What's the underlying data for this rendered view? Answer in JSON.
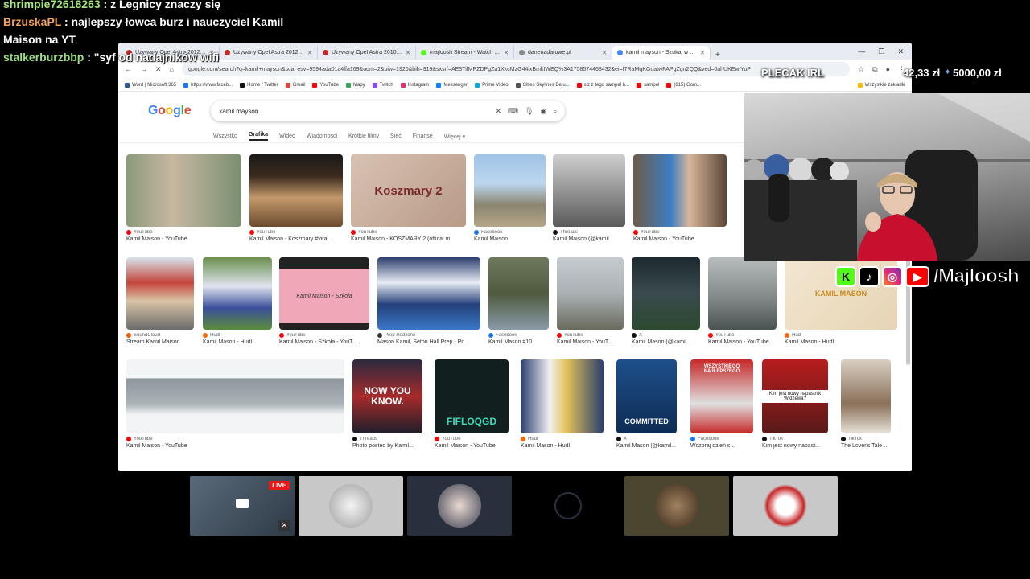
{
  "chat": [
    {
      "user": "shrimpie72618263",
      "user_color": "#a5e67a",
      "message": " : z Legnicy znaczy się"
    },
    {
      "user": "BrzuskaPL",
      "user_color": "#f2a25a",
      "message": " : najlepszy łowca burz i nauczyciel Kamil Maison na YT"
    },
    {
      "user": "stalkerburzbbp",
      "user_color": "#9be07d",
      "message": " : \"syf od nadajników wifi"
    }
  ],
  "browser": {
    "tabs": [
      {
        "title": "Używany Opel Astra 2012 - 1",
        "color": "#c62828"
      },
      {
        "title": "Używany Opel Astra 2012 - 1",
        "color": "#c62828"
      },
      {
        "title": "Używany Opel Astra 2010 - 1",
        "color": "#c62828"
      },
      {
        "title": "majloosh Stream - Watch Live",
        "color": "#53fc18"
      },
      {
        "title": "danenadarowe.pl",
        "color": "#888888"
      },
      {
        "title": "kamil mayson - Szukaj w Goog",
        "color": "#4285f4",
        "active": true
      }
    ],
    "new_tab": "+",
    "url": "google.com/search?q=kamil+mayson&sca_esv=9594ada01a4ffa169&udm=2&biw=1920&bih=919&sxsrf=AE3TifMPZDPgZa1XkcMzG44lxBmkIWEQ%3A1758574463432&ei=f7RaMqKGuatwPAPgZgn2QQ&ved=0ahUKEwiYuP",
    "bookmarks": [
      {
        "label": "Word | Microsoft 365",
        "color": "#2b579a"
      },
      {
        "label": "https://www.faceb...",
        "color": "#1877f2"
      },
      {
        "label": "Home / Twitter",
        "color": "#111111"
      },
      {
        "label": "Gmail",
        "color": "#ea4335"
      },
      {
        "label": "YouTube",
        "color": "#ff0000"
      },
      {
        "label": "Mapy",
        "color": "#34a853"
      },
      {
        "label": "Twitch",
        "color": "#9146ff"
      },
      {
        "label": "Instagram",
        "color": "#e1306c"
      },
      {
        "label": "Messenger",
        "color": "#0084ff"
      },
      {
        "label": "Prime Video",
        "color": "#00a8e1"
      },
      {
        "label": "Cities Skylines Delu...",
        "color": "#555555"
      },
      {
        "label": "siz z tego sampel b...",
        "color": "#ff0000"
      },
      {
        "label": "sampel",
        "color": "#ff0000"
      },
      {
        "label": "(815) Gom...",
        "color": "#ff0000"
      }
    ],
    "bookmarks_folder": "Wszystkie zakładki"
  },
  "google": {
    "logo": "Google",
    "query": "kamil mayson",
    "tabs": [
      "Wszystko",
      "Grafika",
      "Wideo",
      "Wiadomości",
      "Krótkie filmy",
      "Sieć",
      "Finanse",
      "Więcej"
    ],
    "active_tab": "Grafika",
    "results_row1": [
      {
        "source": "YouTube",
        "title": "Kamil Maison - YouTube",
        "src_color": "#ff0000"
      },
      {
        "source": "YouTube",
        "title": "Kamil Maison - Koszmary #viral...",
        "src_color": "#ff0000"
      },
      {
        "source": "YouTube",
        "title": "Kamil Maison - KOSZMARY 2 (offical m",
        "src_color": "#ff0000",
        "overlay": "Koszmary 2"
      },
      {
        "source": "Facebook",
        "title": "Kamil Maison",
        "src_color": "#1877f2"
      },
      {
        "source": "Threads",
        "title": "Kamil Maison (@kamil",
        "src_color": "#111111"
      },
      {
        "source": "YouTube",
        "title": "Kamil Maison - YouTube",
        "src_color": "#ff0000"
      }
    ],
    "results_row2": [
      {
        "source": "SoundCloud",
        "title": "Stream Kamil Maison",
        "src_color": "#ff5500"
      },
      {
        "source": "Hudl",
        "title": "Kamil Mason - Hudl",
        "src_color": "#ff6600"
      },
      {
        "source": "YouTube",
        "title": "Kamil Maison - Szkoła - YouT...",
        "src_color": "#ff0000",
        "overlay": "Kamil Maison - Szkoła"
      },
      {
        "source": "Prep Redzone",
        "title": "Mason Kamil, Seton Hall Prep - Pr...",
        "src_color": "#333333"
      },
      {
        "source": "Facebook",
        "title": "Kamil Mason #10",
        "src_color": "#1877f2"
      },
      {
        "source": "YouTube",
        "title": "Kamil Maison - YouT...",
        "src_color": "#ff0000"
      },
      {
        "source": "X",
        "title": "Kamil Mason (@kamil...",
        "src_color": "#111111"
      },
      {
        "source": "YouTube",
        "title": "Kamil Maison - YouTube",
        "src_color": "#ff0000"
      },
      {
        "source": "Hudl",
        "title": "Kamil Mason - Hudl",
        "src_color": "#ff6600",
        "overlay": "KAMIL MASON"
      }
    ],
    "results_row3": [
      {
        "source": "YouTube",
        "title": "Kamil Maison - YouTube",
        "src_color": "#ff0000"
      },
      {
        "source": "Threads",
        "title": "Photo posted by Kamil...",
        "src_color": "#111111",
        "overlay": "NOW YOU KNOW."
      },
      {
        "source": "YouTube",
        "title": "Kamil Maison - YouTube",
        "src_color": "#ff0000",
        "overlay": "FIFLOQGD"
      },
      {
        "source": "Hudl",
        "title": "Kamil Mason - Hudl",
        "src_color": "#ff6600"
      },
      {
        "source": "X",
        "title": "Kamil Mason (@kamil...",
        "src_color": "#111111",
        "overlay": "COMMITTED"
      },
      {
        "source": "Facebook",
        "title": "Wczoraj dzień s...",
        "src_color": "#1877f2",
        "overlay": "WSZYSTKIEGO NAJLEPSZEGO"
      },
      {
        "source": "TikTok",
        "title": "Kim jest nowy napast...",
        "src_color": "#111111",
        "overlay": "Kim jest nowy napastnik Widzewa?"
      },
      {
        "source": "TikTok",
        "title": "The Lover's Tale Fr...",
        "src_color": "#111111"
      }
    ]
  },
  "overlay": {
    "plecak": "PLECAK IRL",
    "goal_current": "42,33 zł",
    "goal_target": "5000,00 zł",
    "socials": [
      "K",
      "♪",
      "◎",
      "▶"
    ],
    "handle": "/Majloosh"
  },
  "bottom": {
    "live_badge": "LIVE"
  }
}
